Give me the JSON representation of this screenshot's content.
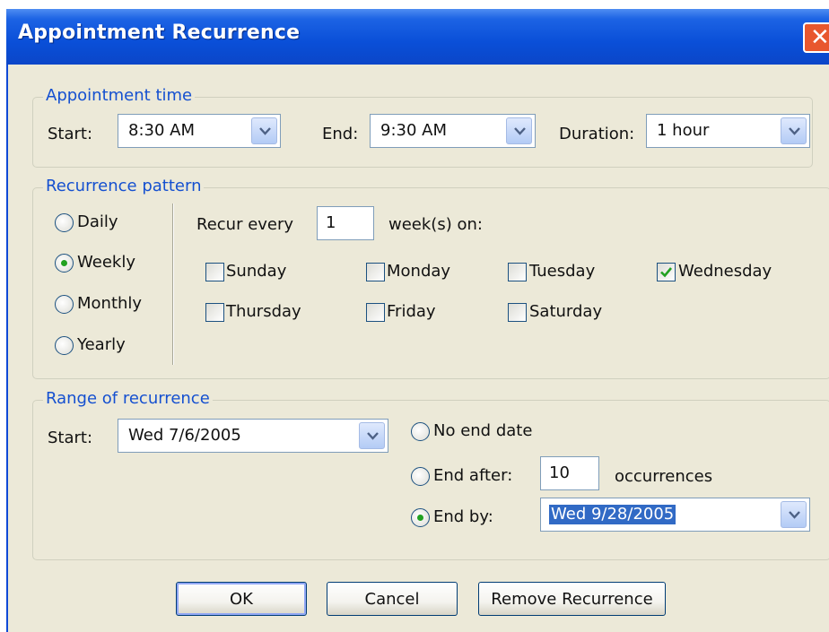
{
  "window": {
    "title": "Appointment Recurrence"
  },
  "appointment_time": {
    "group_label": "Appointment time",
    "start_label": "Start:",
    "start_value": "8:30 AM",
    "end_label": "End:",
    "end_value": "9:30 AM",
    "duration_label": "Duration:",
    "duration_value": "1 hour"
  },
  "recurrence_pattern": {
    "group_label": "Recurrence pattern",
    "options": [
      "Daily",
      "Weekly",
      "Monthly",
      "Yearly"
    ],
    "selected": "Weekly",
    "recur_every_label": "Recur every",
    "recur_every_value": "1",
    "weeks_on_label": "week(s) on:",
    "days": {
      "sunday": {
        "label": "Sunday",
        "checked": false
      },
      "monday": {
        "label": "Monday",
        "checked": false
      },
      "tuesday": {
        "label": "Tuesday",
        "checked": false
      },
      "wednesday": {
        "label": "Wednesday",
        "checked": true
      },
      "thursday": {
        "label": "Thursday",
        "checked": false
      },
      "friday": {
        "label": "Friday",
        "checked": false
      },
      "saturday": {
        "label": "Saturday",
        "checked": false
      }
    }
  },
  "range": {
    "group_label": "Range of recurrence",
    "start_label": "Start:",
    "start_value": "Wed 7/6/2005",
    "no_end_label": "No end date",
    "end_after_label": "End after:",
    "end_after_value": "10",
    "occurrences_label": "occurrences",
    "end_by_label": "End by:",
    "end_by_value": "Wed 9/28/2005",
    "selected": "End by"
  },
  "buttons": {
    "ok": "OK",
    "cancel": "Cancel",
    "remove": "Remove Recurrence"
  },
  "colors": {
    "title_bar": "#0a4fd8",
    "dialog_face": "#ece9d8",
    "group_label": "#1550d0",
    "selection": "#316ac5",
    "close_button": "#e8572e"
  }
}
